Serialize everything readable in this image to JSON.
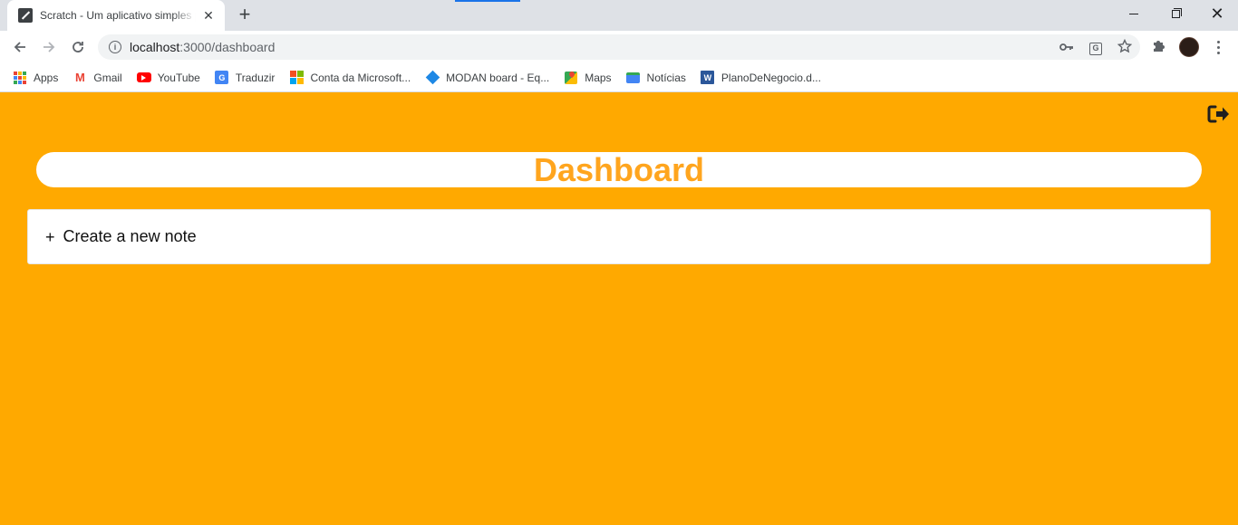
{
  "browser": {
    "tab": {
      "title": "Scratch - Um aplicativo simples p",
      "close_glyph": "✕"
    },
    "new_tab_glyph": "+",
    "window_controls": {
      "close_glyph": "✕"
    },
    "address_bar": {
      "host": "localhost",
      "path": ":3000/dashboard"
    },
    "bookmarks": [
      {
        "label": "Apps",
        "icon": "apps-icon"
      },
      {
        "label": "Gmail",
        "icon": "gmail-icon"
      },
      {
        "label": "YouTube",
        "icon": "youtube-icon"
      },
      {
        "label": "Traduzir",
        "icon": "google-translate-icon"
      },
      {
        "label": "Conta da Microsoft...",
        "icon": "microsoft-icon"
      },
      {
        "label": "MODAN board - Eq...",
        "icon": "modan-icon"
      },
      {
        "label": "Maps",
        "icon": "maps-icon"
      },
      {
        "label": "Notícias",
        "icon": "news-icon"
      },
      {
        "label": "PlanoDeNegocio.d...",
        "icon": "word-icon"
      }
    ]
  },
  "page": {
    "background_color": "#ffa900",
    "title": "Dashboard",
    "title_color": "#ffa51e",
    "new_note": {
      "icon_glyph": "+",
      "label": "Create a new note"
    },
    "logout_icon": "sign-out-icon"
  }
}
